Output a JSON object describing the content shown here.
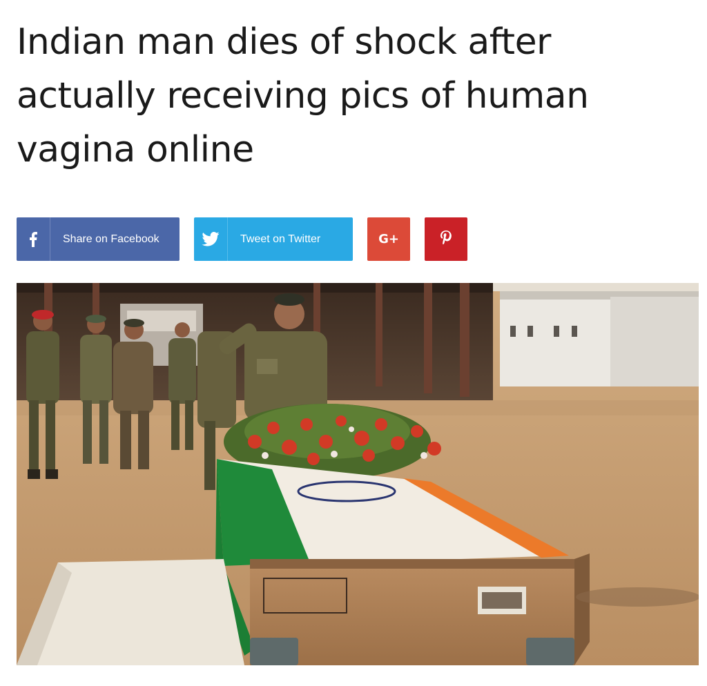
{
  "article": {
    "headline": "Indian man dies of shock after actually receiving pics of human vagina online"
  },
  "share": {
    "facebook_label": "Share on Facebook",
    "twitter_label": "Tweet on Twitter",
    "google_label": "G+",
    "facebook_icon": "facebook-icon",
    "twitter_icon": "twitter-bird-icon",
    "pinterest_icon": "pinterest-icon"
  },
  "colors": {
    "facebook": "#4b67a8",
    "twitter": "#2aa9e4",
    "google": "#dc4a38",
    "pinterest": "#ca2127",
    "headline_text": "#1a1a1a"
  }
}
